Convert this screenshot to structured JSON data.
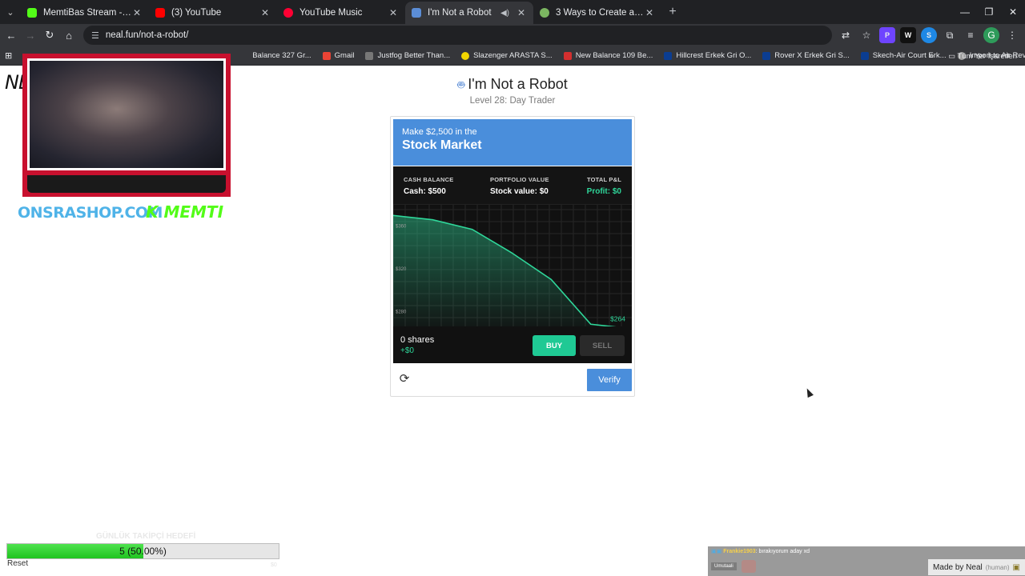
{
  "browser": {
    "tabs": [
      {
        "title": "MemtiBas Stream - Watch Live",
        "color": "#53fc18",
        "active": false
      },
      {
        "title": "(3) YouTube",
        "color": "#ff0000",
        "active": false
      },
      {
        "title": "YouTube Music",
        "color": "#ff0033",
        "active": false
      },
      {
        "title": "I'm Not a Robot",
        "color": "#5b8dd6",
        "active": true
      },
      {
        "title": "3 Ways to Create a Perfect Circle",
        "color": "#7bb661",
        "active": false
      }
    ],
    "url": "neal.fun/not-a-robot/",
    "bookmarks": [
      {
        "label": "Gmail",
        "color": "#ea4335"
      },
      {
        "label": "Justfog Better Than...",
        "color": "#333333"
      },
      {
        "label": "Slazenger ARASTA S...",
        "color": "#f2d600"
      },
      {
        "label": "New Balance 109 Be...",
        "color": "#d32f2f"
      },
      {
        "label": "Hillcrest Erkek Gri O...",
        "color": "#0b3d91"
      },
      {
        "label": "Rover X Erkek Gri S...",
        "color": "#0b3d91"
      },
      {
        "label": "Skech-Air Court Erk...",
        "color": "#0b3d91"
      },
      {
        "label": "Import to Air Reviews",
        "color": "#9e9e9e"
      }
    ],
    "bookmarks_overlap": "Balance 327 Gr...",
    "all_bookmarks": "Tüm Yer İşaretleri"
  },
  "page": {
    "title": "I'm Not a Robot",
    "level": "Level 28: Day Trader"
  },
  "captcha": {
    "prompt_line1": "Make $2,500 in the",
    "prompt_line2": "Stock Market",
    "cash_label": "CASH BALANCE",
    "cash_value": "Cash: $500",
    "portfolio_label": "PORTFOLIO VALUE",
    "portfolio_value": "Stock value: $0",
    "pnl_label": "TOTAL P&L",
    "pnl_value": "Profit: $0",
    "shares": "0 shares",
    "delta": "+$0",
    "buy_label": "BUY",
    "sell_label": "SELL",
    "verify_label": "Verify"
  },
  "chart_data": {
    "type": "line",
    "yticks": [
      280,
      320,
      360
    ],
    "ylim": [
      266,
      380
    ],
    "x": [
      0,
      1,
      2,
      3,
      4,
      5,
      6
    ],
    "values": [
      370,
      366,
      357,
      335,
      310,
      268,
      264
    ],
    "last_label": "$264",
    "line_color": "#2fd79a",
    "grid": true
  },
  "overlay": {
    "ne_text": "NE",
    "shop": "ONSRASHOP.COM",
    "kick": "MEMTI",
    "goal_ghost": "GÜNLÜK TAKİPÇİ HEDEFİ",
    "goal_label": "5 (50.00%)",
    "goal_fraction": 0.5,
    "reset": "Reset",
    "goal_zero": "$0",
    "chat_user": "Frankie1903",
    "chat_msg": ": bırakıyorum aday xd",
    "chat_name2": "Umutaali",
    "made_by": "Made by Neal",
    "human": "(human)"
  },
  "colors": {
    "accent": "#4a8edb",
    "profit_green": "#2fd79a",
    "buy_green": "#1fc994"
  }
}
